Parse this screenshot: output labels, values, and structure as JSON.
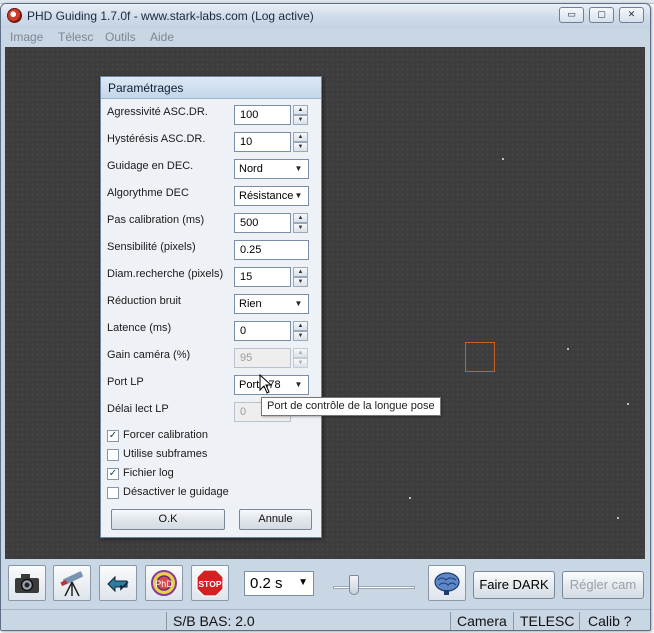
{
  "window": {
    "title": "PHD Guiding 1.7.0f  -  www.stark-labs.com (Log active)",
    "controls": {
      "minimize": "▭",
      "maximize": "▢",
      "close": "✕"
    }
  },
  "menu": [
    "Image",
    "Télesc",
    "Outils",
    "Aide"
  ],
  "dialog": {
    "title": "Paramétrages",
    "fields": {
      "agressivite": {
        "label": "Agressivité ASC.DR.",
        "value": "100"
      },
      "hysteresis": {
        "label": "Hystérésis ASC.DR.",
        "value": "10"
      },
      "guidage_dec": {
        "label": "Guidage en DEC.",
        "value": "Nord"
      },
      "algorythme_dec": {
        "label": "Algorythme DEC",
        "value": "Résistance"
      },
      "pas_calibration": {
        "label": "Pas calibration  (ms)",
        "value": "500"
      },
      "sensibilite": {
        "label": "Sensibilité (pixels)",
        "value": "0.25"
      },
      "diam_recherche": {
        "label": "Diam.recherche (pixels)",
        "value": "15"
      },
      "reduction_bruit": {
        "label": "Réduction bruit",
        "value": "Rien"
      },
      "latence": {
        "label": "Latence (ms)",
        "value": "0"
      },
      "gain_camera": {
        "label": "Gain caméra (%)",
        "value": "95"
      },
      "port_lp": {
        "label": "Port LP",
        "value": "Port 378"
      },
      "delai_lect_lp": {
        "label": "Délai lect LP",
        "value": "0"
      }
    },
    "checkboxes": {
      "forcer_calibration": {
        "label": "Forcer calibration",
        "checked": "✓"
      },
      "utilise_subframes": {
        "label": "Utilise subframes",
        "checked": ""
      },
      "fichier_log": {
        "label": "Fichier log",
        "checked": "✓"
      },
      "desactiver_guidage": {
        "label": "Désactiver le guidage",
        "checked": ""
      }
    },
    "ok_label": "O.K",
    "cancel_label": "Annule",
    "tooltip": "Port de contrôle de la longue pose"
  },
  "toolbar": {
    "exposure": "0.2 s",
    "stop_label": "STOP",
    "faire_dark": "Faire DARK",
    "regler_cam": "Régler cam"
  },
  "status": {
    "snr": "S/B BAS: 2.0",
    "camera": "Camera",
    "telesc": "TELESC",
    "calib": "Calib ?"
  },
  "colors": {
    "target_box": "#c0622a",
    "canvas": "#3d3d3d",
    "chrome": "#c9d6e4"
  }
}
